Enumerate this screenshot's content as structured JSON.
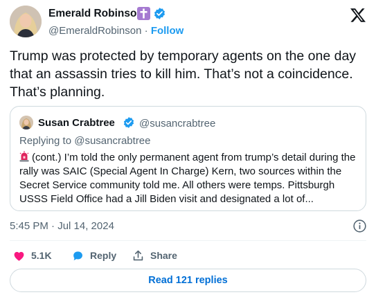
{
  "author": {
    "name": "Emerald Robinson",
    "badge_icon": "latin-cross-icon",
    "badge_color": "#a57ad1",
    "verified_icon": "verified-badge-icon",
    "handle": "@EmeraldRobinson",
    "separator": " · ",
    "follow_label": "Follow"
  },
  "brand": {
    "logo_icon": "x-logo-icon"
  },
  "tweet": {
    "text": "Trump was protected by temporary agents on the one day that an assassin tries to kill him. That’s not a coincidence. That’s planning.",
    "timestamp": "5:45 PM · Jul 14, 2024"
  },
  "quote": {
    "name": "Susan Crabtree",
    "verified_icon": "verified-badge-icon",
    "handle": "@susancrabtree",
    "reply_to": "Replying to @susancrabtree",
    "emoji_icon": "police-siren-icon",
    "text": "(cont.) I’m told the only permanent agent from trump’s detail during the rally was SAIC (Special Agent In Charge) Kern, two sources within the Secret Service community told me. All others were temps. Pittsburgh USSS Field Office had a Jill Biden visit and designated a lot of..."
  },
  "actions": {
    "like_count": "5.1K",
    "reply_label": "Reply",
    "share_label": "Share"
  },
  "read_replies_label": "Read 121 replies",
  "colors": {
    "accent": "#1d9bf0",
    "link": "#006fd6",
    "like": "#f91880",
    "secondary_text": "#536471",
    "border": "#cfd9de"
  }
}
